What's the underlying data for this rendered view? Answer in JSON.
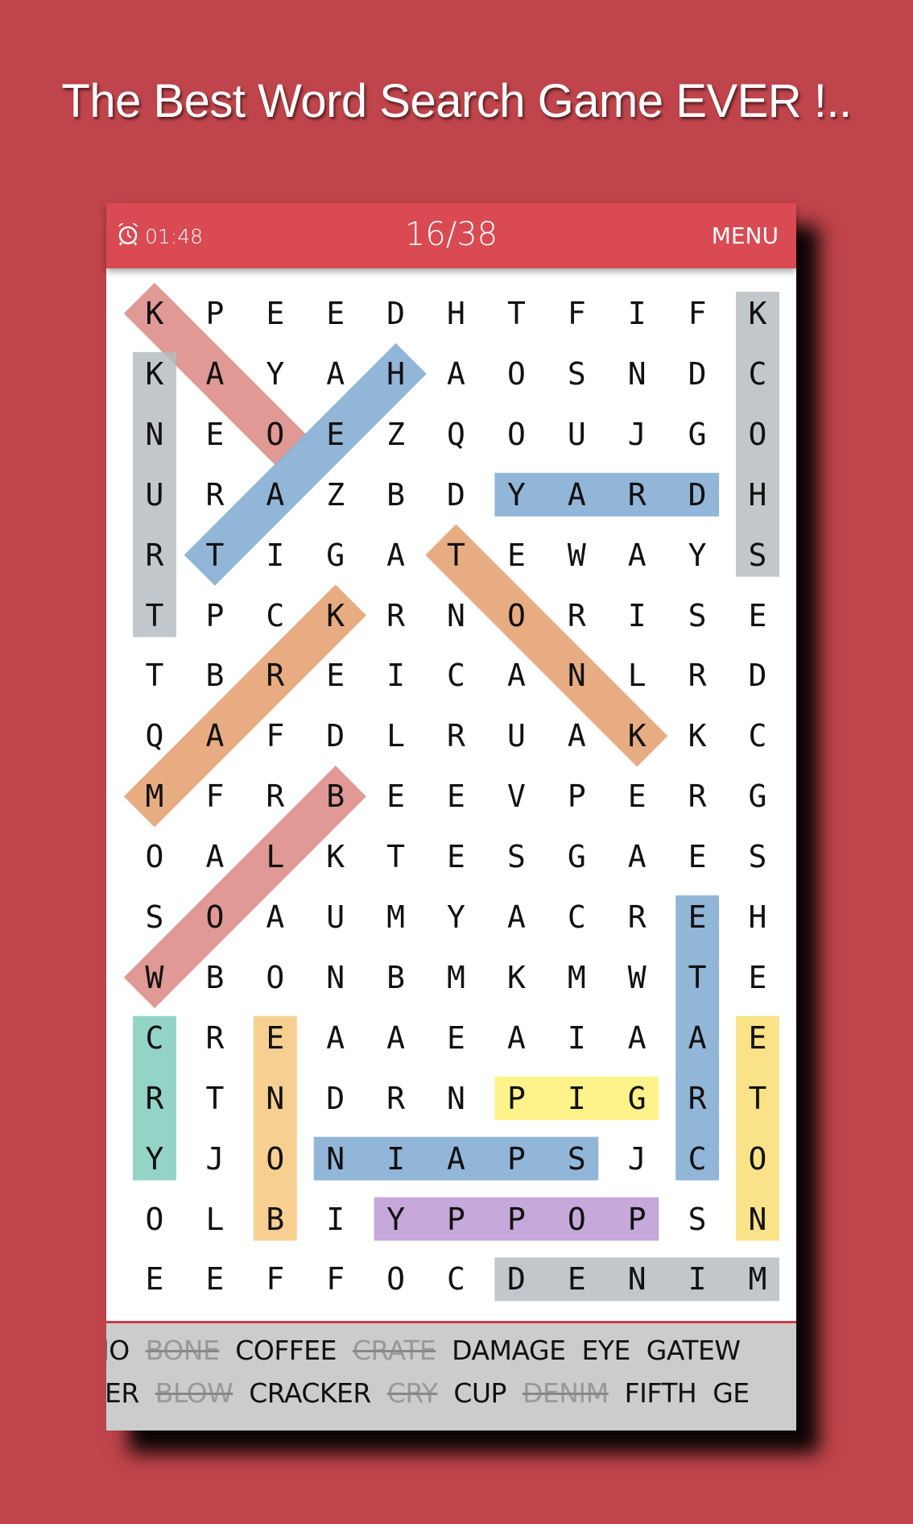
{
  "title": "The Best Word Search Game EVER !..",
  "header": {
    "timer_icon": "alarm-clock-icon",
    "timer": "01:48",
    "progress": "16/38",
    "menu_label": "MENU"
  },
  "colors": {
    "background": "#bf444b",
    "header": "#d94a53",
    "word_list_bg": "#cccccc"
  },
  "grid": [
    "KPEEDHTFIFK",
    "KAYAHAOSNDC",
    "NEOEZQOUJGO",
    "URAZBDYARDH",
    "RTIGATEWAYS",
    "TPCKRNORISE",
    "TBREICANLRD",
    "QAFDLRUAKKC",
    "MFRBEEVPERG",
    "OALKTESGAES",
    "SOAUMYACREH",
    "WBONBMKMWTE",
    "CREAAEAIAAE",
    "RTNDRNPIGRT",
    "YJONIAPSJCO",
    "OLBIYPPOPSN",
    "EEFFOCDENIM"
  ],
  "highlights": [
    {
      "from": [
        0,
        0
      ],
      "to": [
        2,
        2
      ],
      "color": "#d9837c"
    },
    {
      "from": [
        1,
        4
      ],
      "to": [
        4,
        1
      ],
      "color": "#7aa6d0"
    },
    {
      "from": [
        1,
        0
      ],
      "to": [
        5,
        0
      ],
      "color": "#b4bbbf"
    },
    {
      "from": [
        0,
        10
      ],
      "to": [
        4,
        10
      ],
      "color": "#b4bbbf"
    },
    {
      "from": [
        3,
        6
      ],
      "to": [
        3,
        9
      ],
      "color": "#7aa6d0"
    },
    {
      "from": [
        4,
        5
      ],
      "to": [
        7,
        8
      ],
      "color": "#e39a66"
    },
    {
      "from": [
        5,
        3
      ],
      "to": [
        8,
        0
      ],
      "color": "#e39a66"
    },
    {
      "from": [
        8,
        3
      ],
      "to": [
        11,
        0
      ],
      "color": "#d9837c"
    },
    {
      "from": [
        12,
        0
      ],
      "to": [
        14,
        0
      ],
      "color": "#7ccbba"
    },
    {
      "from": [
        12,
        2
      ],
      "to": [
        15,
        2
      ],
      "color": "#f5c679"
    },
    {
      "from": [
        10,
        9
      ],
      "to": [
        14,
        9
      ],
      "color": "#7aa6d0"
    },
    {
      "from": [
        12,
        10
      ],
      "to": [
        15,
        10
      ],
      "color": "#f8dc6e"
    },
    {
      "from": [
        13,
        6
      ],
      "to": [
        13,
        8
      ],
      "color": "#fef070"
    },
    {
      "from": [
        14,
        3
      ],
      "to": [
        14,
        7
      ],
      "color": "#7aa6d0"
    },
    {
      "from": [
        15,
        4
      ],
      "to": [
        15,
        8
      ],
      "color": "#b995d2"
    },
    {
      "from": [
        16,
        6
      ],
      "to": [
        16,
        10
      ],
      "color": "#b4bbbf"
    }
  ],
  "word_list": {
    "row1": [
      {
        "word": "JO",
        "found": false
      },
      {
        "word": "BONE",
        "found": true
      },
      {
        "word": "COFFEE",
        "found": false
      },
      {
        "word": "CRATE",
        "found": true
      },
      {
        "word": "DAMAGE",
        "found": false
      },
      {
        "word": "EYE",
        "found": false
      },
      {
        "word": "GATEW",
        "found": false
      }
    ],
    "row2": [
      {
        "word": "ER",
        "found": false
      },
      {
        "word": "BLOW",
        "found": true
      },
      {
        "word": "CRACKER",
        "found": false
      },
      {
        "word": "CRY",
        "found": true
      },
      {
        "word": "CUP",
        "found": false
      },
      {
        "word": "DENIM",
        "found": true
      },
      {
        "word": "FIFTH",
        "found": false
      },
      {
        "word": "GE",
        "found": false
      }
    ]
  }
}
